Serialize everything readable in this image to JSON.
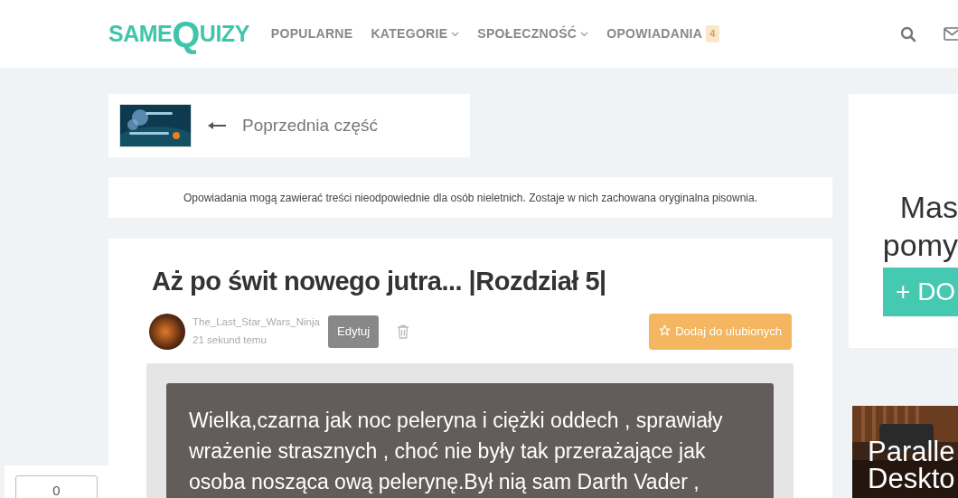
{
  "logo": {
    "parts": [
      "SAME",
      "Q",
      "UIZY"
    ]
  },
  "nav": [
    {
      "label": "POPULARNE",
      "dropdown": false
    },
    {
      "label": "KATEGORIE",
      "dropdown": true
    },
    {
      "label": "SPOŁECZNOŚĆ",
      "dropdown": true
    },
    {
      "label": "OPOWIADANIA",
      "dropdown": false,
      "badge": "4"
    }
  ],
  "previous_part": {
    "label": "Poprzednia część"
  },
  "notice": "Opowiadania mogą zawierać treści nieodpowiednie dla osób nieletnich. Zostaje w nich zachowana oryginalna pisownia.",
  "article": {
    "title": "Aż po świt nowego jutra... |Rozdział 5|",
    "author": "The_Last_Star_Wars_Ninja",
    "time": "21 sekund temu",
    "edit_button": "Edytuj",
    "favorite_button": "Dodaj do ulubionych",
    "body": "Wielka,czarna jak noc peleryna i ciężki oddech , sprawiały wrażenie strasznych , choć nie były tak przerażające jak osoba nosząca ową pelerynę.Był nią sam Darth Vader ,"
  },
  "side_panel": {
    "lines": [
      "Mas",
      "pomy"
    ],
    "button": "+ DO"
  },
  "ad": {
    "lines": [
      "Paralle",
      "Deskto"
    ]
  },
  "counter": {
    "value": "0"
  }
}
